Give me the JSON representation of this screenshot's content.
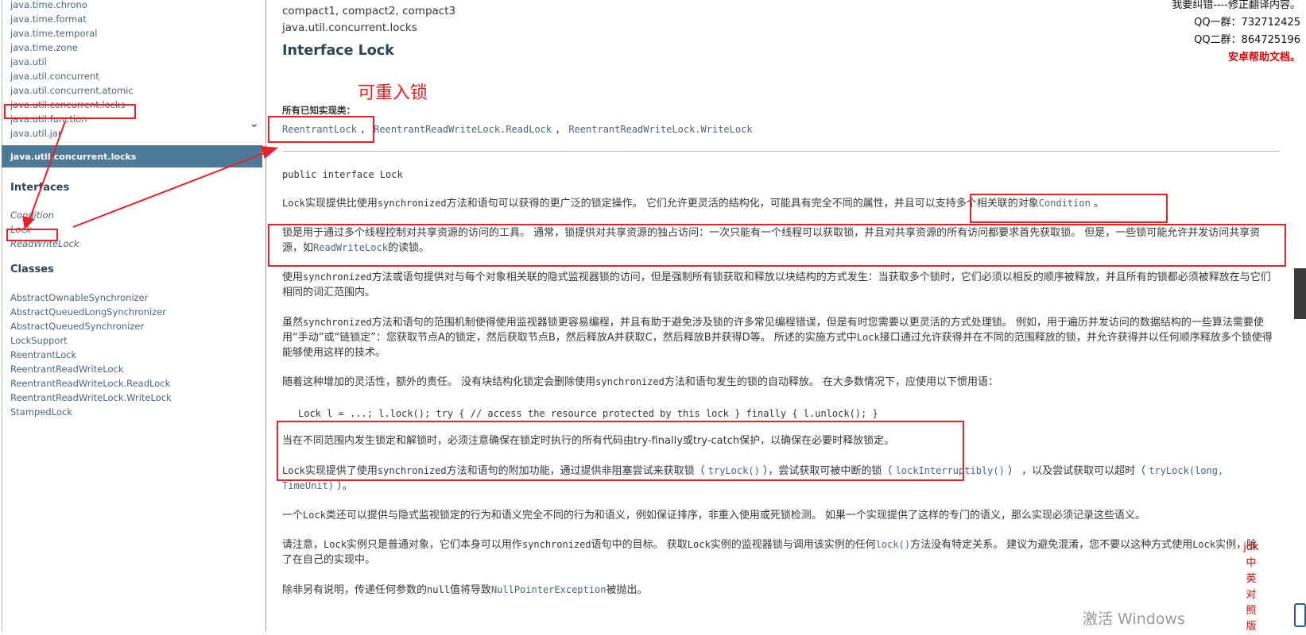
{
  "left_packages": [
    "java.time.chrono",
    "java.time.format",
    "java.time.temporal",
    "java.time.zone",
    "java.util",
    "java.util.concurrent",
    "java.util.concurrent.atomic",
    "java.util.concurrent.locks",
    "java.util.function",
    "java.util.jar"
  ],
  "package_bar": "java.util.concurrent.locks",
  "interfaces_heading": "Interfaces",
  "interfaces": [
    "Condition",
    "Lock",
    "ReadWriteLock"
  ],
  "classes_heading": "Classes",
  "classes": [
    "AbstractOwnableSynchronizer",
    "AbstractQueuedLongSynchronizer",
    "AbstractQueuedSynchronizer",
    "LockSupport",
    "ReentrantLock",
    "ReentrantReadWriteLock",
    "ReentrantReadWriteLock.ReadLock",
    "ReentrantReadWriteLock.WriteLock",
    "StampedLock"
  ],
  "content": {
    "profile": "compact1, compact2, compact3",
    "package": "java.util.concurrent.locks",
    "title": "Interface Lock",
    "impl_label": "所有已知实现类：",
    "impl_classes": [
      "ReentrantLock",
      "ReentrantReadWriteLock.ReadLock",
      "ReentrantReadWriteLock.WriteLock"
    ],
    "impl_separator": ",",
    "declaration": "public interface Lock",
    "p1": {
      "a": "Lock",
      "b": "实现提供比使用",
      "c": "synchronized",
      "d": "方法和语句可以获得的更广泛的锁定操作。 它们允许更灵活的结构化，可能具有完全不同的属性，并且可以支持多个相关联的对象",
      "e": "Condition",
      "f": " 。"
    },
    "p2": {
      "a": "锁是用于通过多个线程控制对共享资源的访问的工具。 通常，锁提供对共享资源的独占访问：一次只能有一个线程可以获取锁，并且对共享资源的所有访问都要求首先获取锁。 但是，一些锁可能允许并发访问共享资源，如",
      "b": "ReadWriteLock",
      "c": "的读锁。"
    },
    "p3": {
      "a": "使用",
      "b": "synchronized",
      "c": "方法或语句提供对与每个对象相关联的隐式监视器锁的访问，但是强制所有锁获取和释放以块结构的方式发生：当获取多个锁时，它们必须以相反的顺序被释放，并且所有的锁都必须被释放在与它们相同的词汇范围内。"
    },
    "p4": {
      "a": "虽然",
      "b": "synchronized",
      "c": "方法和语句的范围机制使得使用监视器锁更容易编程，并且有助于避免涉及锁的许多常见编程错误，但是有时您需要以更灵活的方式处理锁。 例如，用于遍历并发访问的数据结构的一些算法需要使用“手动”或“链锁定”：您获取节点A的锁定，然后获取节点B，然后释放A并获取C，然后释放B并获得D等。 所述的实施方式中",
      "d": "Lock",
      "e": "接口通过允许获得并在不同的范围释放的锁，并允许获得并以任何顺序释放多个锁使得能够使用这样的技术。"
    },
    "p5": {
      "a": "随着这种增加的灵活性，额外的责任。 没有块结构化锁定会删除使用",
      "b": "synchronized",
      "c": "方法和语句发生的锁的自动释放。 在大多数情况下，应使用以下惯用语："
    },
    "code_line": "Lock l = ...; l.lock(); try { // access the resource protected by this lock } finally { l.unlock(); }",
    "p6": "当在不同范围内发生锁定和解锁时，必须注意确保在锁定时执行的所有代码由try-finally或try-catch保护，以确保在必要时释放锁定。",
    "p7": {
      "a": "Lock",
      "b": "实现提供了使用",
      "c": "synchronized",
      "d": "方法和语句的附加功能，通过提供非阻塞尝试来获取锁（ ",
      "e": "tryLock()",
      "f": " ），尝试获取可被中断的锁（ ",
      "g": "lockInterruptibly()",
      "h": " ） ，以及尝试获取可以超时（ ",
      "i": "tryLock(long, TimeUnit)",
      "j": " ）。"
    },
    "p8": {
      "a": "一个",
      "b": "Lock",
      "c": "类还可以提供与隐式监视锁定的行为和语义完全不同的行为和语义，例如保证排序，非重入使用或死锁检测。 如果一个实现提供了这样的专门的语义，那么实现必须记录这些语义。"
    },
    "p9": {
      "a": "请注意，",
      "b": "Lock",
      "c": "实例只是普通对象，它们本身可以用作",
      "d": "synchronized",
      "e": "语句中的目标。 获取",
      "f": "Lock",
      "g": "实例的监视器锁与调用该实例的任何",
      "h": "lock()",
      "i": "方法没有特定关系。 建议为避免混淆，您不要以这种方式使用",
      "j": "Lock",
      "k": "实例，除了在自己的实现中。"
    },
    "p10": {
      "a": "除非另有说明，传递任何参数的",
      "b": "null",
      "c": "值将导致",
      "d": "NullPointerException",
      "e": "被抛出。"
    }
  },
  "top_right": {
    "line1": "我要纠错----修正翻译内容。",
    "line2": "QQ一群：732712425",
    "line3": "QQ二群：864725196",
    "line4": "安卓帮助文档。"
  },
  "annotation_text": "可重入锁",
  "side_vertical": [
    "jdk",
    "中",
    "英",
    "对",
    "照",
    "版"
  ],
  "watermark": "激活 Windows",
  "colors": {
    "link": "#4A6782",
    "package_bar": "#4D7A97",
    "annotation": "#e8202a",
    "title": "#2c4557"
  }
}
